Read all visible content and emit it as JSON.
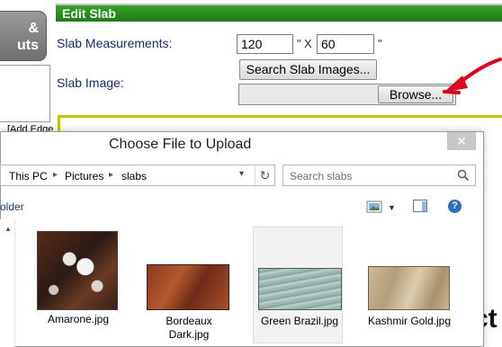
{
  "background_page": {
    "nav_button": {
      "line1": "&",
      "line2": "uts"
    },
    "add_edge_text": "[Add Edge",
    "panel_title": "Edit Slab",
    "measurements_label": "Slab Measurements:",
    "length_value": "120",
    "width_value": "60",
    "unit_symbol_1": "\"",
    "x_separator": "X",
    "unit_symbol_2": "\"",
    "image_label": "Slab Image:",
    "search_images_button": "Search Slab Images...",
    "browse_button": "Browse...",
    "trailing_letters": "ct",
    "colors": {
      "header_green": "#2f8f22",
      "label_navy": "#1b2a6b",
      "arrow_red": "#e0001a",
      "rule_yellow": "#c7c300"
    }
  },
  "dialog": {
    "title": "Choose File to Upload",
    "close_glyph": "✕",
    "breadcrumb": [
      "This PC",
      "Pictures",
      "slabs"
    ],
    "search_placeholder": "Search slabs",
    "toolbar_left_text": "older",
    "help_glyph": "?",
    "files": [
      {
        "name": "Amarone.jpg",
        "selected": false
      },
      {
        "name": "Bordeaux Dark.jpg",
        "line1": "Bordeaux",
        "line2": "Dark.jpg",
        "selected": false
      },
      {
        "name": "Green Brazil.jpg",
        "selected": true
      },
      {
        "name": "Kashmir Gold.jpg",
        "selected": false
      }
    ],
    "icons": [
      "close-icon",
      "chevron-right-icon",
      "refresh-icon",
      "search-icon",
      "view-options-icon",
      "preview-pane-icon",
      "help-icon",
      "scroll-up-icon"
    ]
  }
}
